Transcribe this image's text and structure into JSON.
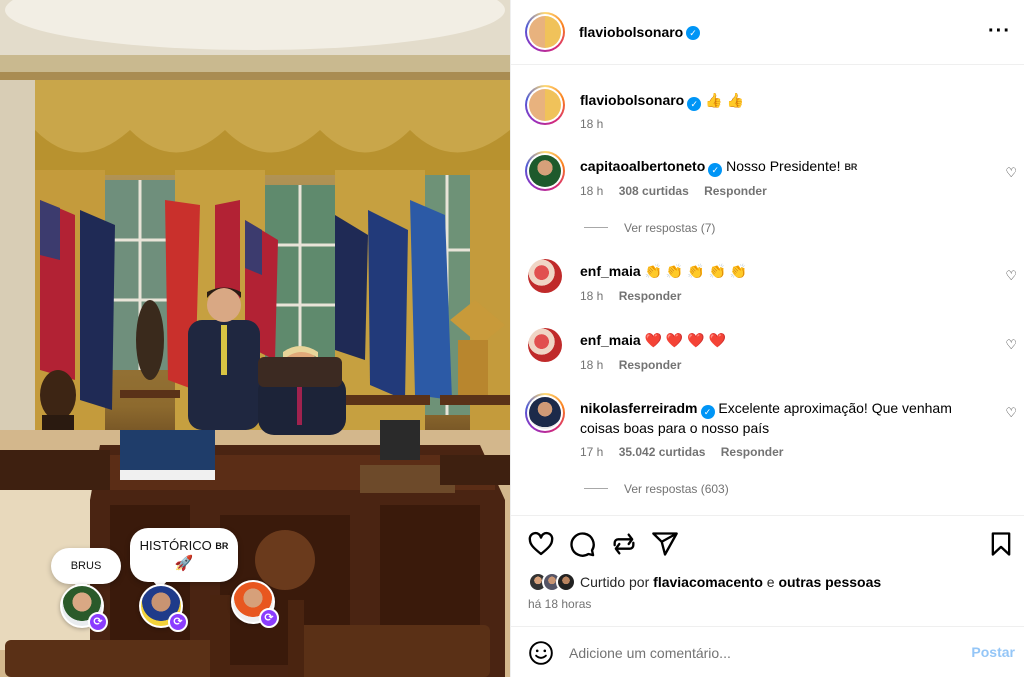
{
  "post": {
    "author": "flaviobolsonaro",
    "caption_emoji": "👍 👍",
    "caption_time": "18 h",
    "more_icon": "more-horizontal-icon"
  },
  "photo": {
    "bubbles": [
      {
        "text": "BRUS"
      },
      {
        "text": "HISTÓRICO",
        "tag": "BR",
        "emoji": "🚀"
      }
    ]
  },
  "comments": [
    {
      "user": "capitaoalbertoneto",
      "verified": true,
      "text": "Nosso Presidente!",
      "tag": "BR",
      "time": "18 h",
      "likes": "308 curtidas",
      "reply": "Responder",
      "view_replies": "Ver respostas (7)"
    },
    {
      "user": "enf_maia",
      "verified": false,
      "text": "👏 👏 👏 👏 👏",
      "time": "18 h",
      "reply": "Responder"
    },
    {
      "user": "enf_maia",
      "verified": false,
      "text": "❤️ ❤️ ❤️ ❤️",
      "time": "18 h",
      "reply": "Responder"
    },
    {
      "user": "nikolasferreiradm",
      "verified": true,
      "text": "Excelente aproximação! Que venham coisas boas para o nosso país",
      "time": "17 h",
      "likes": "35.042 curtidas",
      "reply": "Responder",
      "view_replies": "Ver respostas (603)"
    }
  ],
  "actions": {
    "liked_prefix": "Curtido por",
    "liked_user": "flaviacomacento",
    "liked_mid": "e",
    "liked_suffix": "outras pessoas",
    "time_ago": "há 18 horas"
  },
  "add_comment": {
    "placeholder": "Adicione um comentário...",
    "post_label": "Postar"
  },
  "colors": {
    "verified": "#0095f6",
    "post_button_disabled": "#94c6f7",
    "meta_text": "#737373"
  }
}
